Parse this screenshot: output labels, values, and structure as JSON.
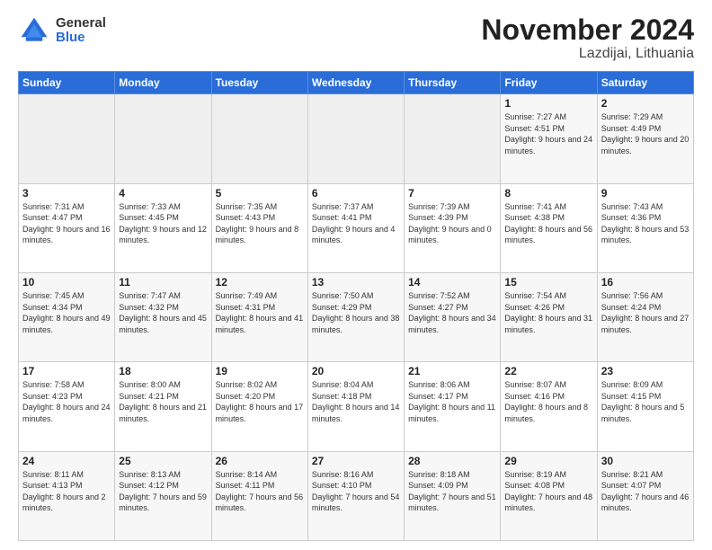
{
  "logo": {
    "general": "General",
    "blue": "Blue"
  },
  "title": "November 2024",
  "subtitle": "Lazdijai, Lithuania",
  "days": [
    "Sunday",
    "Monday",
    "Tuesday",
    "Wednesday",
    "Thursday",
    "Friday",
    "Saturday"
  ],
  "weeks": [
    [
      {
        "date": "",
        "info": ""
      },
      {
        "date": "",
        "info": ""
      },
      {
        "date": "",
        "info": ""
      },
      {
        "date": "",
        "info": ""
      },
      {
        "date": "",
        "info": ""
      },
      {
        "date": "1",
        "info": "Sunrise: 7:27 AM\nSunset: 4:51 PM\nDaylight: 9 hours and 24 minutes."
      },
      {
        "date": "2",
        "info": "Sunrise: 7:29 AM\nSunset: 4:49 PM\nDaylight: 9 hours and 20 minutes."
      }
    ],
    [
      {
        "date": "3",
        "info": "Sunrise: 7:31 AM\nSunset: 4:47 PM\nDaylight: 9 hours and 16 minutes."
      },
      {
        "date": "4",
        "info": "Sunrise: 7:33 AM\nSunset: 4:45 PM\nDaylight: 9 hours and 12 minutes."
      },
      {
        "date": "5",
        "info": "Sunrise: 7:35 AM\nSunset: 4:43 PM\nDaylight: 9 hours and 8 minutes."
      },
      {
        "date": "6",
        "info": "Sunrise: 7:37 AM\nSunset: 4:41 PM\nDaylight: 9 hours and 4 minutes."
      },
      {
        "date": "7",
        "info": "Sunrise: 7:39 AM\nSunset: 4:39 PM\nDaylight: 9 hours and 0 minutes."
      },
      {
        "date": "8",
        "info": "Sunrise: 7:41 AM\nSunset: 4:38 PM\nDaylight: 8 hours and 56 minutes."
      },
      {
        "date": "9",
        "info": "Sunrise: 7:43 AM\nSunset: 4:36 PM\nDaylight: 8 hours and 53 minutes."
      }
    ],
    [
      {
        "date": "10",
        "info": "Sunrise: 7:45 AM\nSunset: 4:34 PM\nDaylight: 8 hours and 49 minutes."
      },
      {
        "date": "11",
        "info": "Sunrise: 7:47 AM\nSunset: 4:32 PM\nDaylight: 8 hours and 45 minutes."
      },
      {
        "date": "12",
        "info": "Sunrise: 7:49 AM\nSunset: 4:31 PM\nDaylight: 8 hours and 41 minutes."
      },
      {
        "date": "13",
        "info": "Sunrise: 7:50 AM\nSunset: 4:29 PM\nDaylight: 8 hours and 38 minutes."
      },
      {
        "date": "14",
        "info": "Sunrise: 7:52 AM\nSunset: 4:27 PM\nDaylight: 8 hours and 34 minutes."
      },
      {
        "date": "15",
        "info": "Sunrise: 7:54 AM\nSunset: 4:26 PM\nDaylight: 8 hours and 31 minutes."
      },
      {
        "date": "16",
        "info": "Sunrise: 7:56 AM\nSunset: 4:24 PM\nDaylight: 8 hours and 27 minutes."
      }
    ],
    [
      {
        "date": "17",
        "info": "Sunrise: 7:58 AM\nSunset: 4:23 PM\nDaylight: 8 hours and 24 minutes."
      },
      {
        "date": "18",
        "info": "Sunrise: 8:00 AM\nSunset: 4:21 PM\nDaylight: 8 hours and 21 minutes."
      },
      {
        "date": "19",
        "info": "Sunrise: 8:02 AM\nSunset: 4:20 PM\nDaylight: 8 hours and 17 minutes."
      },
      {
        "date": "20",
        "info": "Sunrise: 8:04 AM\nSunset: 4:18 PM\nDaylight: 8 hours and 14 minutes."
      },
      {
        "date": "21",
        "info": "Sunrise: 8:06 AM\nSunset: 4:17 PM\nDaylight: 8 hours and 11 minutes."
      },
      {
        "date": "22",
        "info": "Sunrise: 8:07 AM\nSunset: 4:16 PM\nDaylight: 8 hours and 8 minutes."
      },
      {
        "date": "23",
        "info": "Sunrise: 8:09 AM\nSunset: 4:15 PM\nDaylight: 8 hours and 5 minutes."
      }
    ],
    [
      {
        "date": "24",
        "info": "Sunrise: 8:11 AM\nSunset: 4:13 PM\nDaylight: 8 hours and 2 minutes."
      },
      {
        "date": "25",
        "info": "Sunrise: 8:13 AM\nSunset: 4:12 PM\nDaylight: 7 hours and 59 minutes."
      },
      {
        "date": "26",
        "info": "Sunrise: 8:14 AM\nSunset: 4:11 PM\nDaylight: 7 hours and 56 minutes."
      },
      {
        "date": "27",
        "info": "Sunrise: 8:16 AM\nSunset: 4:10 PM\nDaylight: 7 hours and 54 minutes."
      },
      {
        "date": "28",
        "info": "Sunrise: 8:18 AM\nSunset: 4:09 PM\nDaylight: 7 hours and 51 minutes."
      },
      {
        "date": "29",
        "info": "Sunrise: 8:19 AM\nSunset: 4:08 PM\nDaylight: 7 hours and 48 minutes."
      },
      {
        "date": "30",
        "info": "Sunrise: 8:21 AM\nSunset: 4:07 PM\nDaylight: 7 hours and 46 minutes."
      }
    ]
  ]
}
